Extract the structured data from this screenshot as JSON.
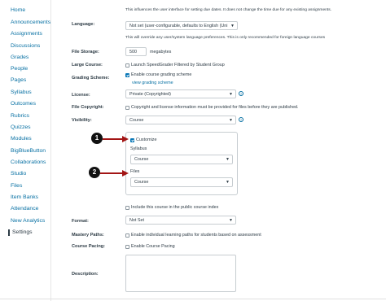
{
  "sidebar": {
    "items": [
      {
        "label": "Home"
      },
      {
        "label": "Announcements"
      },
      {
        "label": "Assignments"
      },
      {
        "label": "Discussions"
      },
      {
        "label": "Grades"
      },
      {
        "label": "People"
      },
      {
        "label": "Pages"
      },
      {
        "label": "Syllabus"
      },
      {
        "label": "Outcomes"
      },
      {
        "label": "Rubrics"
      },
      {
        "label": "Quizzes"
      },
      {
        "label": "Modules"
      },
      {
        "label": "BigBlueButton"
      },
      {
        "label": "Collaborations"
      },
      {
        "label": "Studio"
      },
      {
        "label": "Files"
      },
      {
        "label": "Item Banks"
      },
      {
        "label": "Attendance"
      },
      {
        "label": "New Analytics"
      },
      {
        "label": "Settings"
      }
    ]
  },
  "form": {
    "top_note": "This influences the user interface for setting due dates. It does not change the time due for any existing assignments.",
    "language": {
      "label": "Language:",
      "value": "Not set (user-configurable, defaults to English (Uni",
      "note": "This will override any user/system language preferences. This is only recommended for foreign language courses"
    },
    "file_storage": {
      "label": "File Storage:",
      "value": "500",
      "unit": "megabytes"
    },
    "large_course": {
      "label": "Large Course:",
      "option": "Launch SpeedGrader Filtered by Student Group"
    },
    "grading_scheme": {
      "label": "Grading Scheme:",
      "option": "Enable course grading scheme",
      "link": "view grading scheme"
    },
    "license": {
      "label": "License:",
      "value": "Private (Copyrighted)"
    },
    "file_copyright": {
      "label": "File Copyright:",
      "option": "Copyright and license information must be provided for files before they are published."
    },
    "visibility": {
      "label": "Visibility:",
      "value": "Course",
      "customize": "Customize",
      "syllabus_label": "Syllabus",
      "syllabus_value": "Course",
      "files_label": "Files",
      "files_value": "Course"
    },
    "public_index": {
      "option": "Include this course in the public course index"
    },
    "format": {
      "label": "Format:",
      "value": "Not Set"
    },
    "mastery_paths": {
      "label": "Mastery Paths:",
      "option": "Enable individual learning paths for students based on assessment"
    },
    "course_pacing": {
      "label": "Course Pacing:",
      "option": "Enable Course Pacing"
    },
    "description": {
      "label": "Description:"
    }
  },
  "callouts": {
    "one": "1",
    "two": "2"
  },
  "colors": {
    "link": "#0770a3",
    "accent": "#0374b5",
    "callout": "#a31515"
  }
}
